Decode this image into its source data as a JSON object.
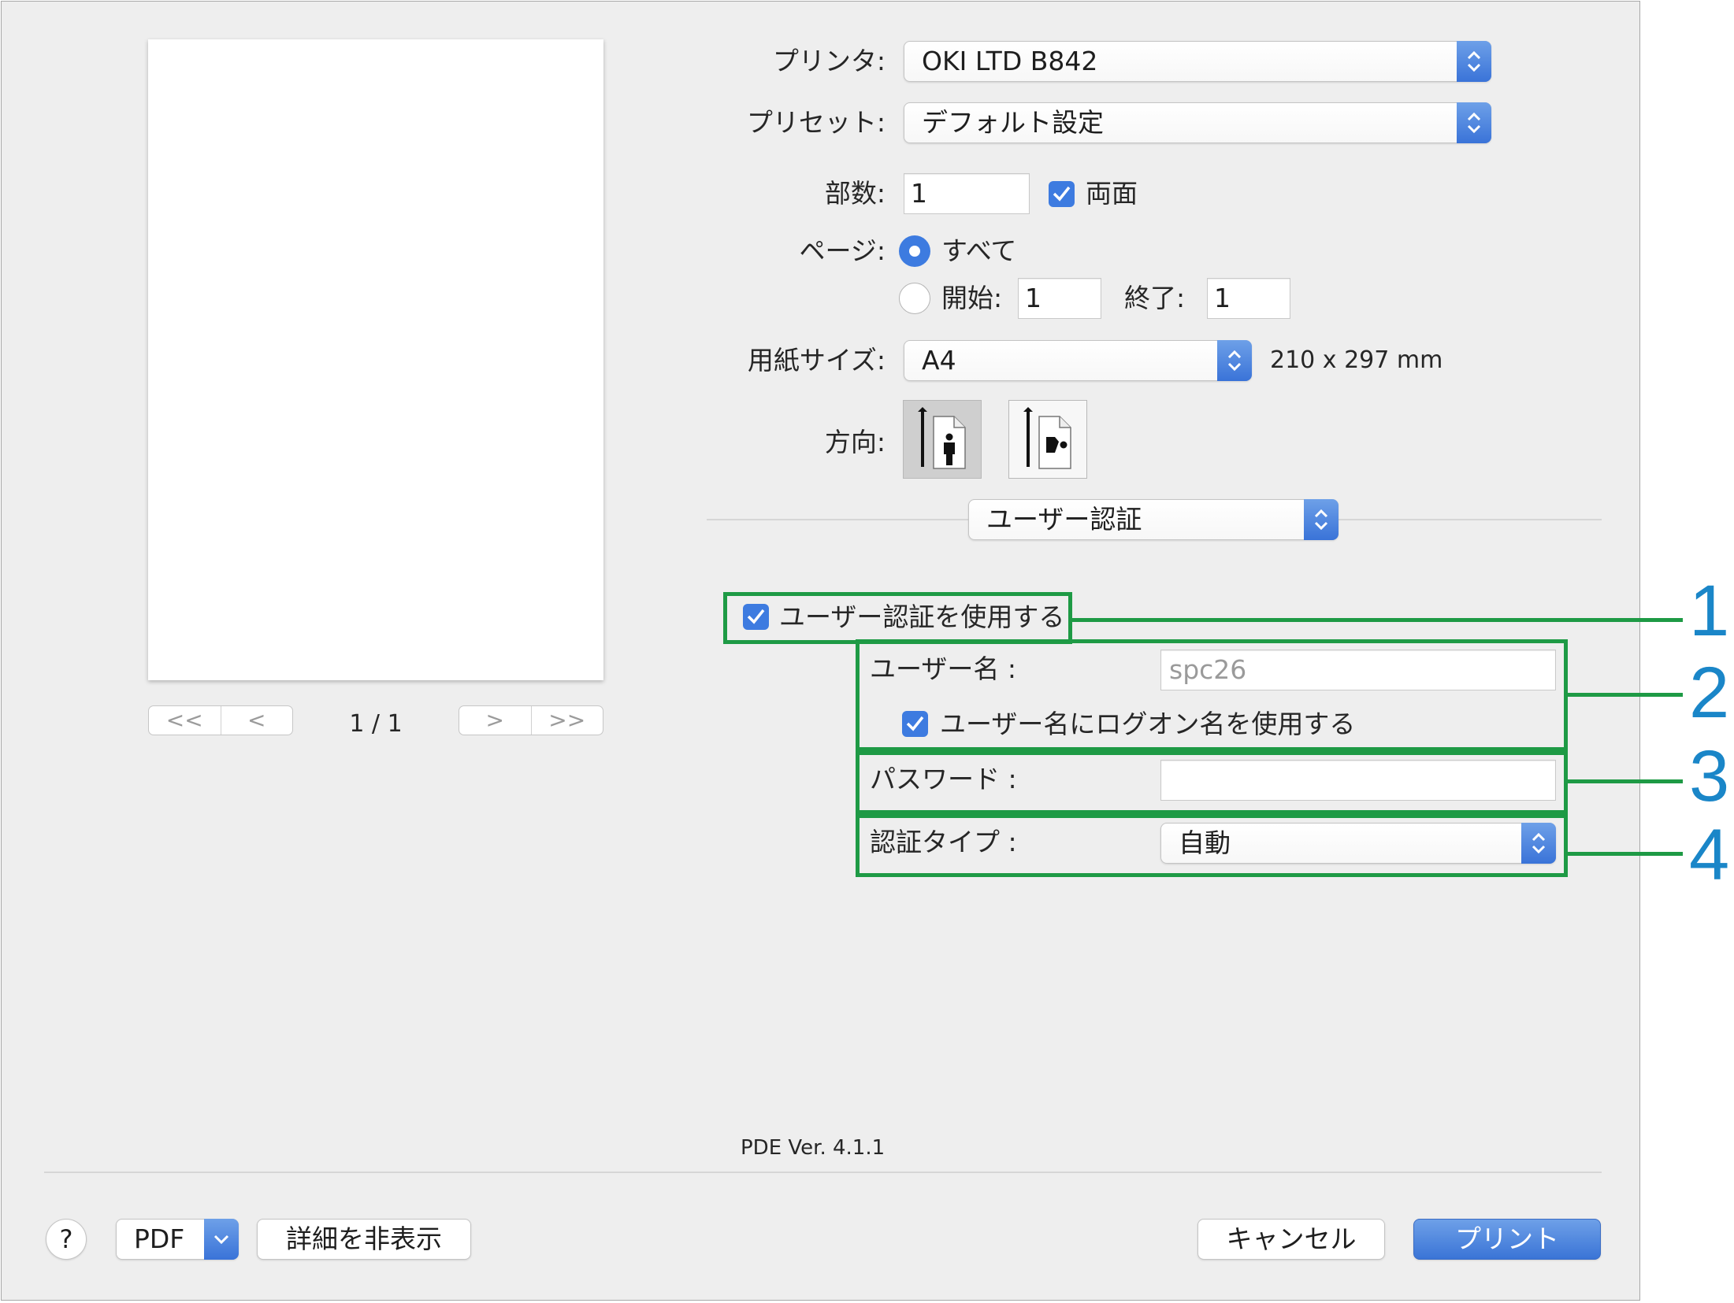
{
  "printer": {
    "label": "プリンタ:",
    "value": "OKI LTD B842"
  },
  "preset": {
    "label": "プリセット:",
    "value": "デフォルト設定"
  },
  "copies": {
    "label": "部数:",
    "value": "1",
    "duplex_label": "両面",
    "duplex_checked": true
  },
  "pages": {
    "label": "ページ:",
    "all_label": "すべて",
    "from_label": "開始:",
    "from_value": "1",
    "to_label": "終了:",
    "to_value": "1",
    "selected": "all"
  },
  "paper_size": {
    "label": "用紙サイズ:",
    "value": "A4",
    "dimensions": "210 x 297 mm"
  },
  "orientation": {
    "label": "方向:",
    "selected": "portrait"
  },
  "panel_select": {
    "value": "ユーザー認証"
  },
  "auth": {
    "use_auth_label": "ユーザー認証を使用する",
    "use_auth_checked": true,
    "username_label": "ユーザー名 :",
    "username_value": "spc26",
    "use_logon_label": "ユーザー名にログオン名を使用する",
    "use_logon_checked": true,
    "password_label": "パスワード :",
    "password_value": "",
    "auth_type_label": "認証タイプ :",
    "auth_type_value": "自動"
  },
  "preview": {
    "page_indicator": "1 / 1",
    "first_glyph": "<<",
    "prev_glyph": "<",
    "next_glyph": ">",
    "last_glyph": ">>"
  },
  "version": "PDE Ver. 4.1.1",
  "bottom": {
    "help": "?",
    "pdf": "PDF",
    "hide_details": "詳細を非表示",
    "cancel": "キャンセル",
    "print": "プリント"
  },
  "callouts": [
    "1",
    "2",
    "3",
    "4"
  ],
  "colors": {
    "accent": "#3d7be0",
    "callout_box": "#1e9a45",
    "callout_number": "#1a86c8",
    "print_button": "#3a74d6"
  }
}
